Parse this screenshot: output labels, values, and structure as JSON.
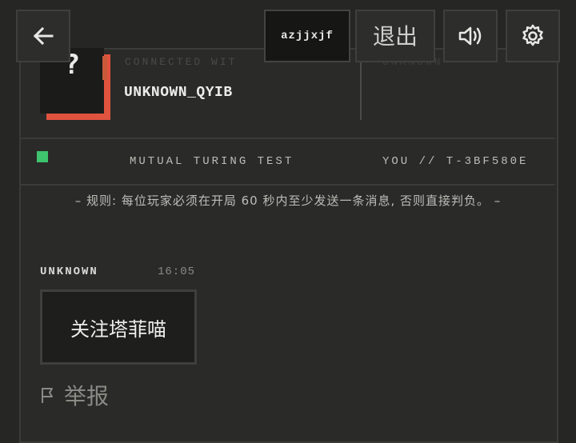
{
  "topbar": {
    "back_icon": "arrow-left-icon",
    "room_code": "azjjxjf",
    "exit_label": "退出",
    "sound_icon": "speaker-icon",
    "settings_icon": "gear-icon"
  },
  "opponent": {
    "avatar_glyph": "?",
    "connected_label": "CONNECTED WIT",
    "name": "UNKNOWN_QYIB",
    "right_label": "UNKNOWN"
  },
  "chat": {
    "title": "MUTUAL TURING TEST",
    "id": "YOU // T-3BF580E",
    "status_color": "#3ec46d",
    "rules": "– 规则: 每位玩家必须在开局 60 秒内至少发送一条消息, 否则直接判负。 –"
  },
  "message": {
    "sender": "UNKNOWN",
    "time": "16:05",
    "text": "关注塔菲喵"
  },
  "report": {
    "icon": "flag-icon",
    "label": "举报"
  },
  "colors": {
    "accent": "#e0533f",
    "background": "#262624"
  }
}
